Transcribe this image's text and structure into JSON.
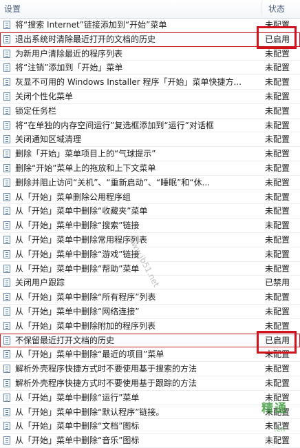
{
  "header": {
    "setting": "设置",
    "state": "状态"
  },
  "rows": [
    {
      "name": "将“搜索 Internet”链接添加到“开始”菜单",
      "state": "未配置"
    },
    {
      "name": "退出系统时清除最近打开的文档的历史",
      "state": "已启用"
    },
    {
      "name": "为新用户清除最近的程序列表",
      "state": "未配置"
    },
    {
      "name": "将“注销”添加到「开始」菜单",
      "state": "未配置"
    },
    {
      "name": "灰显不可用的 Windows Installer 程序「开始」菜单快捷方...",
      "state": "未配置"
    },
    {
      "name": "关闭个性化菜单",
      "state": "未配置"
    },
    {
      "name": "锁定任务栏",
      "state": "未配置"
    },
    {
      "name": "将“在单独的内存空间运行”复选框添加到“运行”对话框",
      "state": "未配置"
    },
    {
      "name": "关闭通知区域清理",
      "state": "未配置"
    },
    {
      "name": "删除「开始」菜单项目上的“气球提示”",
      "state": "未配置"
    },
    {
      "name": "删除“开始”菜单上的拖放和上下文菜单",
      "state": "未配置"
    },
    {
      "name": "删除并阻止访问“关机”、“重新启动”、“睡眠”和“休...",
      "state": "未配置"
    },
    {
      "name": "从「开始」菜单删除公用程序组",
      "state": "未配置"
    },
    {
      "name": "从「开始」菜单中删除“收藏夹”菜单",
      "state": "未配置"
    },
    {
      "name": "从「开始」菜单中删除“搜索”链接",
      "state": "未配置"
    },
    {
      "name": "从「开始」菜单中删除常用程序列表",
      "state": "未配置"
    },
    {
      "name": "从「开始」菜单中删除“游戏”链接",
      "state": "未配置"
    },
    {
      "name": "从「开始」菜单中删除“帮助”菜单",
      "state": "未配置"
    },
    {
      "name": "关闭用户跟踪",
      "state": "已禁用"
    },
    {
      "name": "从「开始」菜单中删除“所有程序”列表",
      "state": "未配置"
    },
    {
      "name": "从「开始」菜单中删除“网络连接”",
      "state": "未配置"
    },
    {
      "name": "从「开始」菜单中删除附加的程序列表",
      "state": "未配置"
    },
    {
      "name": "不保留最近打开文档的历史",
      "state": "已启用"
    },
    {
      "name": "从「开始」菜单中删除“最近的项目”菜单",
      "state": "未配置"
    },
    {
      "name": "解析外壳程序快捷方式时不要使用基于搜索的方法",
      "state": "未配置"
    },
    {
      "name": "解析外壳程序快捷方式时不要使用基于跟踪的方法",
      "state": "未配置"
    },
    {
      "name": "从「开始」菜单中删除“运行”菜单",
      "state": "未配置"
    },
    {
      "name": "从「开始」菜单中删除“默认程序”链接。",
      "state": "未配置"
    },
    {
      "name": "从「开始」菜单中删除“文档”图标",
      "state": "未配置"
    },
    {
      "name": "从「开始」菜单中删除“音乐”图标",
      "state": "未配置"
    }
  ],
  "watermark": {
    "site": "www.jb51.net",
    "brand": "精通",
    "brand_sub": ".cn"
  },
  "colors": {
    "highlight": "#d0121b",
    "header_text": "#4c607a"
  }
}
